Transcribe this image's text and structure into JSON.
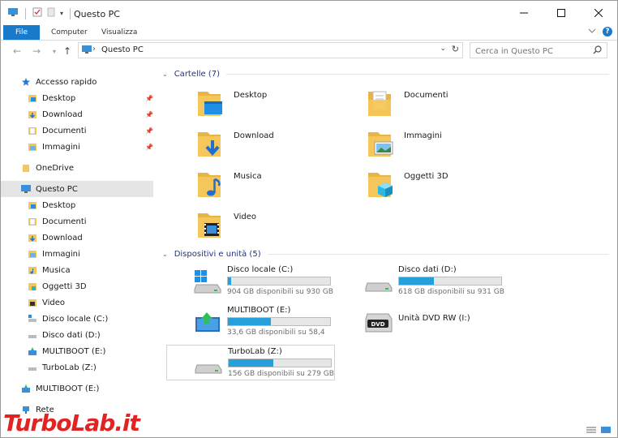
{
  "window": {
    "title": "Questo PC"
  },
  "ribbon": {
    "tabs": [
      "File",
      "Computer",
      "Visualizza"
    ]
  },
  "address": {
    "crumb": "Questo PC"
  },
  "search": {
    "placeholder": "Cerca in Questo PC"
  },
  "nav": {
    "items": [
      {
        "label": "Accesso rapido",
        "icon": "star-icon"
      },
      {
        "label": "Desktop",
        "icon": "desktop-folder-icon",
        "pinned": true
      },
      {
        "label": "Download",
        "icon": "download-folder-icon",
        "pinned": true
      },
      {
        "label": "Documenti",
        "icon": "documents-folder-icon",
        "pinned": true
      },
      {
        "label": "Immagini",
        "icon": "pictures-folder-icon",
        "pinned": true
      },
      {
        "label": "OneDrive",
        "icon": "onedrive-folder-icon"
      },
      {
        "label": "Questo PC",
        "icon": "pc-icon",
        "selected": true
      },
      {
        "label": "Desktop",
        "icon": "desktop-folder-icon"
      },
      {
        "label": "Documenti",
        "icon": "documents-folder-icon"
      },
      {
        "label": "Download",
        "icon": "download-folder-icon"
      },
      {
        "label": "Immagini",
        "icon": "pictures-folder-icon"
      },
      {
        "label": "Musica",
        "icon": "music-folder-icon"
      },
      {
        "label": "Oggetti 3D",
        "icon": "3d-objects-folder-icon"
      },
      {
        "label": "Video",
        "icon": "video-folder-icon"
      },
      {
        "label": "Disco locale (C:)",
        "icon": "drive-icon"
      },
      {
        "label": "Disco dati (D:)",
        "icon": "drive-icon"
      },
      {
        "label": "MULTIBOOT (E:)",
        "icon": "usb-drive-icon"
      },
      {
        "label": "TurboLab (Z:)",
        "icon": "drive-icon"
      },
      {
        "label": "MULTIBOOT (E:)",
        "icon": "usb-drive-icon"
      },
      {
        "label": "Rete",
        "icon": "network-icon"
      }
    ]
  },
  "folders": {
    "header": "Cartelle (7)",
    "items": [
      {
        "label": "Desktop",
        "icon": "desktop-folder-icon"
      },
      {
        "label": "Documenti",
        "icon": "documents-folder-icon"
      },
      {
        "label": "Download",
        "icon": "download-folder-icon"
      },
      {
        "label": "Immagini",
        "icon": "pictures-folder-icon"
      },
      {
        "label": "Musica",
        "icon": "music-folder-icon"
      },
      {
        "label": "Oggetti 3D",
        "icon": "3d-objects-folder-icon"
      },
      {
        "label": "Video",
        "icon": "video-folder-icon"
      }
    ]
  },
  "devices": {
    "header": "Dispositivi e unità (5)",
    "items": [
      {
        "label": "Disco locale (C:)",
        "sub": "904 GB disponibili su 930 GB",
        "used_fraction": 0.03,
        "icon": "windows-drive-icon"
      },
      {
        "label": "Disco dati (D:)",
        "sub": "618 GB disponibili su 931 GB",
        "used_fraction": 0.34,
        "icon": "drive-icon"
      },
      {
        "label": "MULTIBOOT (E:)",
        "sub": "33,6 GB disponibili su 58,4",
        "used_fraction": 0.42,
        "icon": "usb-drive-icon"
      },
      {
        "label": "Unità DVD RW (I:)",
        "sub": "",
        "icon": "dvd-drive-icon"
      },
      {
        "label": "TurboLab (Z:)",
        "sub": "156 GB disponibili su 279 GB",
        "used_fraction": 0.44,
        "icon": "drive-icon",
        "selected": true
      }
    ]
  },
  "watermark": "TurboLab.it",
  "colors": {
    "accent": "#1979ca",
    "bar": "#26a0da",
    "folder": "#f5c65a"
  }
}
